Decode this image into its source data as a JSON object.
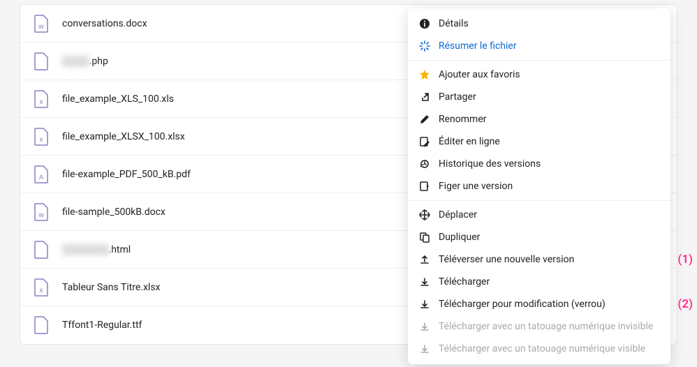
{
  "files": [
    {
      "name": "conversations.docx",
      "icon": "docx"
    },
    {
      "name_prefix_blur": "xxxxx",
      "name_suffix": ".php",
      "icon": "generic"
    },
    {
      "name": "file_example_XLS_100.xls",
      "icon": "xls"
    },
    {
      "name": "file_example_XLSX_100.xlsx",
      "icon": "xls"
    },
    {
      "name": "file-example_PDF_500_kB.pdf",
      "icon": "pdf"
    },
    {
      "name": "file-sample_500kB.docx",
      "icon": "docx"
    },
    {
      "name_prefix_blur": "xxxxxxxxx",
      "name_suffix": ".html",
      "icon": "generic"
    },
    {
      "name": "Tableur Sans Titre.xlsx",
      "icon": "xls"
    },
    {
      "name": "Tffont1-Regular.ttf",
      "icon": "generic"
    }
  ],
  "menu": {
    "details": "Détails",
    "summarize": "Résumer le fichier",
    "favorite": "Ajouter aux favoris",
    "share": "Partager",
    "rename": "Renommer",
    "edit_online": "Éditer en ligne",
    "version_history": "Historique des versions",
    "freeze_version": "Figer une version",
    "move": "Déplacer",
    "duplicate": "Dupliquer",
    "upload_new_version": "Téléverser une nouvelle version",
    "download": "Télécharger",
    "download_edit_lock": "Télécharger pour modification (verrou)",
    "download_invisible_watermark": "Télécharger avec un tatouage numérique invisible",
    "download_visible_watermark": "Télécharger avec un tatouage numérique visible"
  },
  "annotations": {
    "one": "(1)",
    "two": "(2)"
  }
}
